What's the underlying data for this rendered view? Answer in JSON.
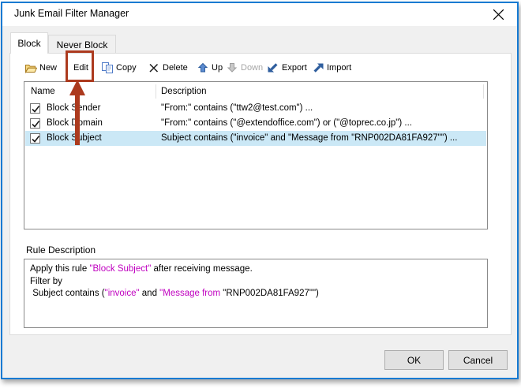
{
  "window": {
    "title": "Junk Email Filter Manager"
  },
  "tabs": {
    "items": [
      {
        "label": "Block",
        "active": true
      },
      {
        "label": "Never Block",
        "active": false
      }
    ]
  },
  "toolbar": {
    "items": [
      {
        "id": "new",
        "label": "New",
        "icon": "new-folder-icon"
      },
      {
        "id": "edit",
        "label": "Edit",
        "icon": null,
        "annotated": true
      },
      {
        "id": "copy",
        "label": "Copy",
        "icon": "copy-icon"
      },
      {
        "id": "delete",
        "label": "Delete",
        "icon": "delete-x-icon"
      },
      {
        "id": "up",
        "label": "Up",
        "icon": "arrow-up-icon"
      },
      {
        "id": "down",
        "label": "Down",
        "icon": "arrow-down-icon",
        "disabled": true
      },
      {
        "id": "export",
        "label": "Export",
        "icon": "export-arrow-icon"
      },
      {
        "id": "import",
        "label": "Import",
        "icon": "import-arrow-icon"
      }
    ]
  },
  "list": {
    "columns": [
      {
        "label": "Name"
      },
      {
        "label": "Description"
      }
    ],
    "rows": [
      {
        "name": "Block Sender",
        "checked": true,
        "selected": false,
        "description": "\"From:\" contains (\"ttw2@test.com\") ..."
      },
      {
        "name": "Block Domain",
        "checked": true,
        "selected": false,
        "description": "\"From:\" contains (\"@extendoffice.com\") or (\"@toprec.co.jp\") ..."
      },
      {
        "name": "Block Subject",
        "checked": true,
        "selected": true,
        "description": "Subject contains (\"invoice\" and \"Message from \"RNP002DA81FA927\"\") ..."
      }
    ]
  },
  "rule_description": {
    "label": "Rule Description",
    "lines": [
      [
        {
          "text": "Apply this rule ",
          "color": "default"
        },
        {
          "text": "\"Block Subject\"",
          "color": "accent"
        },
        {
          "text": " after receiving message.",
          "color": "default"
        }
      ],
      [
        {
          "text": "Filter by",
          "color": "default"
        }
      ],
      [
        {
          "text": " Subject contains (",
          "color": "default"
        },
        {
          "text": "\"invoice\"",
          "color": "accent"
        },
        {
          "text": " and ",
          "color": "default"
        },
        {
          "text": "\"Message from ",
          "color": "accent"
        },
        {
          "text": "\"RNP002DA81FA927\"\"",
          "color": "default"
        },
        {
          "text": ")",
          "color": "default"
        }
      ]
    ]
  },
  "footer": {
    "ok_label": "OK",
    "cancel_label": "Cancel"
  },
  "colors": {
    "accent_text": "#C000C0",
    "selection_bg": "#CBE8F6",
    "annotation": "#AC3A1E",
    "dialog_border": "#157AD2"
  }
}
